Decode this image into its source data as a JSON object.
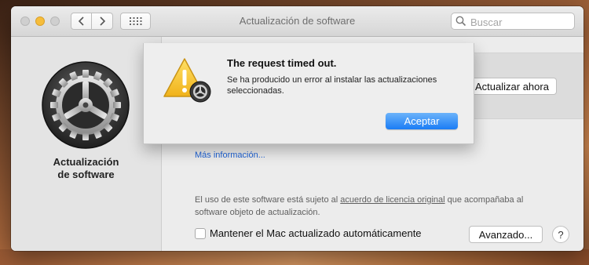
{
  "window": {
    "title": "Actualización de software"
  },
  "toolbar": {
    "search_placeholder": "Buscar"
  },
  "sidebar": {
    "label_line1": "Actualización",
    "label_line2": "de software"
  },
  "main": {
    "update_now_label": "Actualizar ahora",
    "more_info_link": "Más información...",
    "legal_prefix": "El uso de este software está sujeto al ",
    "legal_link": "acuerdo de licencia original",
    "legal_suffix": " que acompañaba al software objeto de actualización.",
    "auto_update_label": "Mantener el Mac actualizado automáticamente",
    "auto_update_checked": false,
    "advanced_label": "Avanzado...",
    "help_label": "?"
  },
  "alert": {
    "title": "The request timed out.",
    "message": "Se ha producido un error al instalar las actualizaciones seleccionadas.",
    "ok_label": "Aceptar"
  },
  "colors": {
    "accent_blue": "#1a7cf5",
    "link_blue": "#1f63d6",
    "minimize_yellow": "#f6bd3b",
    "warning_yellow": "#f7c52b"
  }
}
